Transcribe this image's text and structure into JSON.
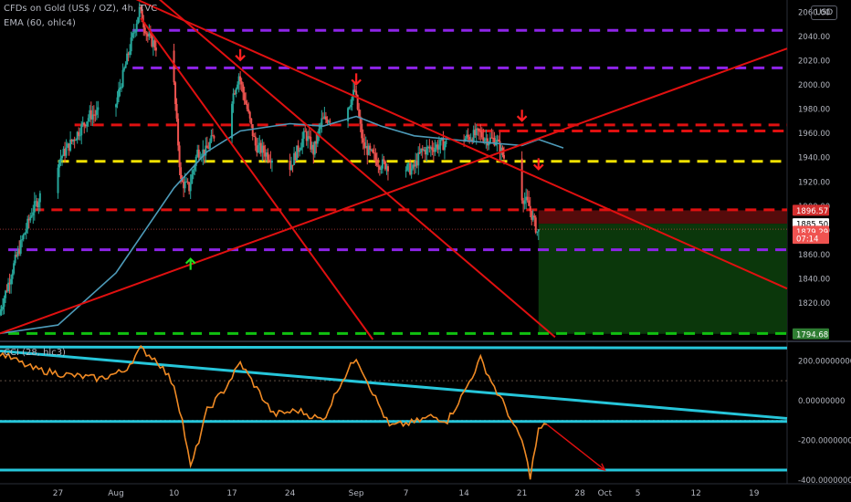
{
  "header": {
    "symbol": "CFDs on Gold (US$ / OZ), 4h, TVC",
    "indicator": "EMA (60, ohlc4)",
    "currency_badge": "USD"
  },
  "cci_panel": {
    "label": "CCI (28, hlc3)",
    "ticks": [
      "200.00000000",
      "0.00000000",
      "-200.00000000",
      "-400.00000000"
    ]
  },
  "colors": {
    "background": "#000000",
    "candle_up": "#26a69a",
    "candle_down": "#ef5350",
    "ema_line": "#4d9ab8",
    "trendline": "#e01010",
    "level_purple": "#8e24e8",
    "level_red": "#e01010",
    "level_yellow": "#f0e000",
    "level_green": "#10c010",
    "cci_line": "#f08a24",
    "cci_channel": "#26c6da",
    "stop_zone": "#5a0c0c",
    "target_zone": "#0c3a0c"
  },
  "chart_data": [
    {
      "type": "candlestick",
      "title": "CFDs on Gold (US$ / OZ), 4h, TVC",
      "ylim": [
        1790,
        2070
      ],
      "y_ticks": [
        1820,
        1840,
        1860,
        1880,
        1900,
        1920,
        1940,
        1960,
        1980,
        2000,
        2020,
        2040,
        2060
      ],
      "y_tick_labels": [
        "1820.00",
        "1840.00",
        "1860.00",
        "1880.00",
        "1900.00",
        "1920.00",
        "1940.00",
        "1960.00",
        "1980.00",
        "2000.00",
        "2020.00",
        "2040.00",
        "2060.00"
      ],
      "x_tick_labels": [
        "27",
        "Aug",
        "10",
        "17",
        "24",
        "Sep",
        "7",
        "14",
        "21",
        "28",
        "Oct",
        "5",
        "12",
        "19"
      ],
      "x_range": [
        "2020-07-20",
        "2020-10-23"
      ],
      "x_ticks": [
        "2020-07-27",
        "2020-08-03",
        "2020-08-10",
        "2020-08-17",
        "2020-08-24",
        "2020-09-01",
        "2020-09-07",
        "2020-09-14",
        "2020-09-21",
        "2020-09-28",
        "2020-10-01",
        "2020-10-05",
        "2020-10-12",
        "2020-10-19"
      ],
      "price_path": [
        [
          "2020-07-20",
          1810
        ],
        [
          "2020-07-22",
          1855
        ],
        [
          "2020-07-24",
          1895
        ],
        [
          "2020-07-27",
          1935
        ],
        [
          "2020-07-29",
          1955
        ],
        [
          "2020-07-31",
          1975
        ],
        [
          "2020-08-03",
          1980
        ],
        [
          "2020-08-05",
          2035
        ],
        [
          "2020-08-06",
          2062
        ],
        [
          "2020-08-07",
          2040
        ],
        [
          "2020-08-10",
          2015
        ],
        [
          "2020-08-11",
          1920
        ],
        [
          "2020-08-12",
          1915
        ],
        [
          "2020-08-13",
          1945
        ],
        [
          "2020-08-14",
          1945
        ],
        [
          "2020-08-17",
          1985
        ],
        [
          "2020-08-18",
          2008
        ],
        [
          "2020-08-19",
          1980
        ],
        [
          "2020-08-20",
          1950
        ],
        [
          "2020-08-24",
          1930
        ],
        [
          "2020-08-26",
          1960
        ],
        [
          "2020-08-27",
          1945
        ],
        [
          "2020-08-28",
          1970
        ],
        [
          "2020-08-31",
          1980
        ],
        [
          "2020-09-01",
          1995
        ],
        [
          "2020-09-02",
          1950
        ],
        [
          "2020-09-04",
          1935
        ],
        [
          "2020-09-08",
          1930
        ],
        [
          "2020-09-09",
          1945
        ],
        [
          "2020-09-11",
          1950
        ],
        [
          "2020-09-14",
          1955
        ],
        [
          "2020-09-16",
          1960
        ],
        [
          "2020-09-17",
          1955
        ],
        [
          "2020-09-18",
          1955
        ],
        [
          "2020-09-21",
          1910
        ],
        [
          "2020-09-22",
          1900
        ],
        [
          "2020-09-23",
          1879
        ]
      ],
      "series": [
        {
          "name": "EMA (60, ohlc4)",
          "points": [
            [
              "2020-07-20",
              1795
            ],
            [
              "2020-07-27",
              1802
            ],
            [
              "2020-08-03",
              1845
            ],
            [
              "2020-08-10",
              1915
            ],
            [
              "2020-08-14",
              1945
            ],
            [
              "2020-08-18",
              1962
            ],
            [
              "2020-08-24",
              1968
            ],
            [
              "2020-08-28",
              1966
            ],
            [
              "2020-09-01",
              1974
            ],
            [
              "2020-09-04",
              1966
            ],
            [
              "2020-09-08",
              1958
            ],
            [
              "2020-09-14",
              1954
            ],
            [
              "2020-09-21",
              1950
            ],
            [
              "2020-09-23",
              1955
            ],
            [
              "2020-09-26",
              1948
            ]
          ]
        }
      ],
      "price_tags": [
        {
          "value": 1896.57,
          "label": "1896.57",
          "color": "#d32f2f",
          "text_color": "#ffffff"
        },
        {
          "value": 1885.5,
          "label": "1885.50",
          "color": "#ffffff",
          "text_color": "#000000"
        },
        {
          "value": 1879.29,
          "label": "1879.29",
          "color": "#ef5350",
          "text_color": "#ffffff"
        },
        {
          "value": 1873.5,
          "label": "07:14",
          "color": "#ef5350",
          "text_color": "#ffffff"
        },
        {
          "value": 1794.68,
          "label": "1794.68",
          "color": "#2e7d32",
          "text_color": "#ffffff"
        }
      ],
      "horizontal_levels": [
        {
          "value": 2045,
          "color": "purple",
          "from": "2020-08-05"
        },
        {
          "value": 2014,
          "color": "purple",
          "from": "2020-08-05"
        },
        {
          "value": 1967,
          "color": "red",
          "from": "2020-07-29"
        },
        {
          "value": 1962,
          "color": "red",
          "from": "2020-09-16"
        },
        {
          "value": 1937,
          "color": "yellow",
          "from": "2020-07-27"
        },
        {
          "value": 1897,
          "color": "red",
          "from": "2020-07-24"
        },
        {
          "value": 1864,
          "color": "purple",
          "from": "2020-07-21"
        },
        {
          "value": 1795,
          "color": "green",
          "from": "2020-07-21"
        }
      ],
      "trendlines": [
        {
          "from": [
            "2020-08-05",
            2072
          ],
          "to": [
            "2020-10-23",
            1832
          ]
        },
        {
          "from": [
            "2020-08-06",
            2055
          ],
          "to": [
            "2020-09-03",
            1790
          ]
        },
        {
          "from": [
            "2020-08-08",
            2072
          ],
          "to": [
            "2020-09-25",
            1792
          ]
        },
        {
          "from": [
            "2020-07-20",
            1795
          ],
          "to": [
            "2020-10-23",
            2030
          ]
        }
      ],
      "markers": [
        {
          "date": "2020-08-18",
          "value": 2025,
          "direction": "down"
        },
        {
          "date": "2020-09-01",
          "value": 2005,
          "direction": "down"
        },
        {
          "date": "2020-09-21",
          "value": 1975,
          "direction": "down"
        },
        {
          "date": "2020-09-23",
          "value": 1935,
          "direction": "down"
        },
        {
          "date": "2020-08-12",
          "value": 1852,
          "direction": "up"
        }
      ],
      "position_tool": {
        "from": "2020-09-23",
        "to": "2020-10-23",
        "entry": 1885.5,
        "stop": 1896.57,
        "target": 1794.68
      }
    },
    {
      "type": "line",
      "title": "CCI (28, hlc3)",
      "ylim": [
        -410,
        280
      ],
      "y_ticks": [
        200,
        0,
        -200,
        -400
      ],
      "y_tick_labels": [
        "200.00000000",
        "0.00000000",
        "-200.00000000",
        "-400.00000000"
      ],
      "x_range": [
        "2020-07-20",
        "2020-10-23"
      ],
      "reference_levels": [
        100,
        -100
      ],
      "series": [
        {
          "name": "CCI (28, hlc3)",
          "points": [
            [
              "2020-07-20",
              240
            ],
            [
              "2020-07-24",
              160
            ],
            [
              "2020-07-28",
              130
            ],
            [
              "2020-08-01",
              110
            ],
            [
              "2020-08-04",
              150
            ],
            [
              "2020-08-06",
              260
            ],
            [
              "2020-08-08",
              200
            ],
            [
              "2020-08-10",
              80
            ],
            [
              "2020-08-11",
              -100
            ],
            [
              "2020-08-12",
              -340
            ],
            [
              "2020-08-13",
              -200
            ],
            [
              "2020-08-14",
              -50
            ],
            [
              "2020-08-16",
              50
            ],
            [
              "2020-08-18",
              190
            ],
            [
              "2020-08-20",
              60
            ],
            [
              "2020-08-22",
              -70
            ],
            [
              "2020-08-25",
              -50
            ],
            [
              "2020-08-28",
              -100
            ],
            [
              "2020-08-30",
              80
            ],
            [
              "2020-09-01",
              220
            ],
            [
              "2020-09-03",
              40
            ],
            [
              "2020-09-05",
              -130
            ],
            [
              "2020-09-08",
              -110
            ],
            [
              "2020-09-10",
              -80
            ],
            [
              "2020-09-12",
              -100
            ],
            [
              "2020-09-14",
              40
            ],
            [
              "2020-09-16",
              210
            ],
            [
              "2020-09-18",
              40
            ],
            [
              "2020-09-19",
              -30
            ],
            [
              "2020-09-20",
              -130
            ],
            [
              "2020-09-21",
              -200
            ],
            [
              "2020-09-22",
              -380
            ],
            [
              "2020-09-23",
              -150
            ],
            [
              "2020-09-24",
              -120
            ]
          ]
        },
        {
          "name": "forecast",
          "points": [
            [
              "2020-09-24",
              -120
            ],
            [
              "2020-10-01",
              -350
            ]
          ]
        }
      ],
      "channel_lines": [
        {
          "from": [
            "2020-07-20",
            270
          ],
          "to": [
            "2020-10-23",
            265
          ]
        },
        {
          "from": [
            "2020-07-20",
            250
          ],
          "to": [
            "2020-10-23",
            -90
          ]
        },
        {
          "from": [
            "2020-07-20",
            -105
          ],
          "to": [
            "2020-10-23",
            -105
          ]
        },
        {
          "from": [
            "2020-07-20",
            -350
          ],
          "to": [
            "2020-10-23",
            -350
          ]
        }
      ]
    }
  ]
}
